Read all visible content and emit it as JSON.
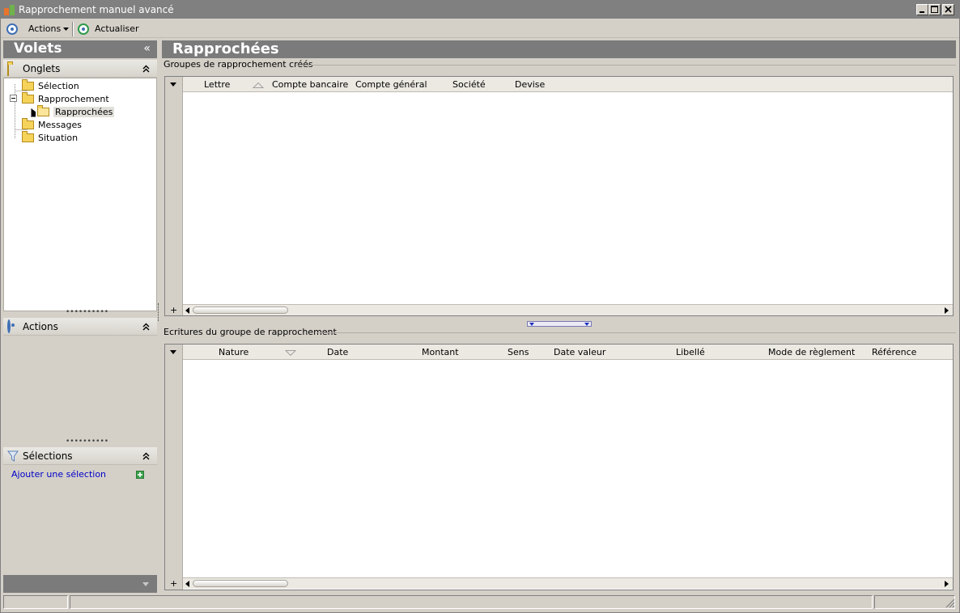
{
  "window": {
    "title": "Rapprochement manuel avancé",
    "controls": [
      "minimize-icon",
      "maximize-icon",
      "close-icon"
    ]
  },
  "toolbar": {
    "actions_label": "Actions",
    "refresh_label": "Actualiser"
  },
  "left_panel": {
    "title": "Volets",
    "collapse_glyph": "«",
    "onglets": {
      "label": "Onglets",
      "items": [
        {
          "label": "Sélection"
        },
        {
          "label": "Rapprochement"
        },
        {
          "label": "Rapprochées",
          "selected": true
        },
        {
          "label": "Messages"
        },
        {
          "label": "Situation"
        }
      ]
    },
    "actions": {
      "label": "Actions"
    },
    "selections": {
      "label": "Sélections",
      "add_label": "Ajouter une sélection"
    }
  },
  "main": {
    "title": "Rapprochées",
    "group1": {
      "title": "Groupes de rapprochement créés",
      "columns": [
        "Lettre",
        "Compte bancaire",
        "Compte général",
        "Société",
        "Devise"
      ]
    },
    "group2": {
      "title": "Ecritures du groupe de rapprochement",
      "columns": [
        "Nature",
        "Date",
        "Montant",
        "Sens",
        "Date valeur",
        "Libellé",
        "Mode de règlement",
        "Référence"
      ]
    }
  },
  "colors": {
    "titlebar": "#808080",
    "panel_header": "#7b7b7b",
    "link": "#0000c8",
    "accent_blue": "#3f6fb5"
  }
}
